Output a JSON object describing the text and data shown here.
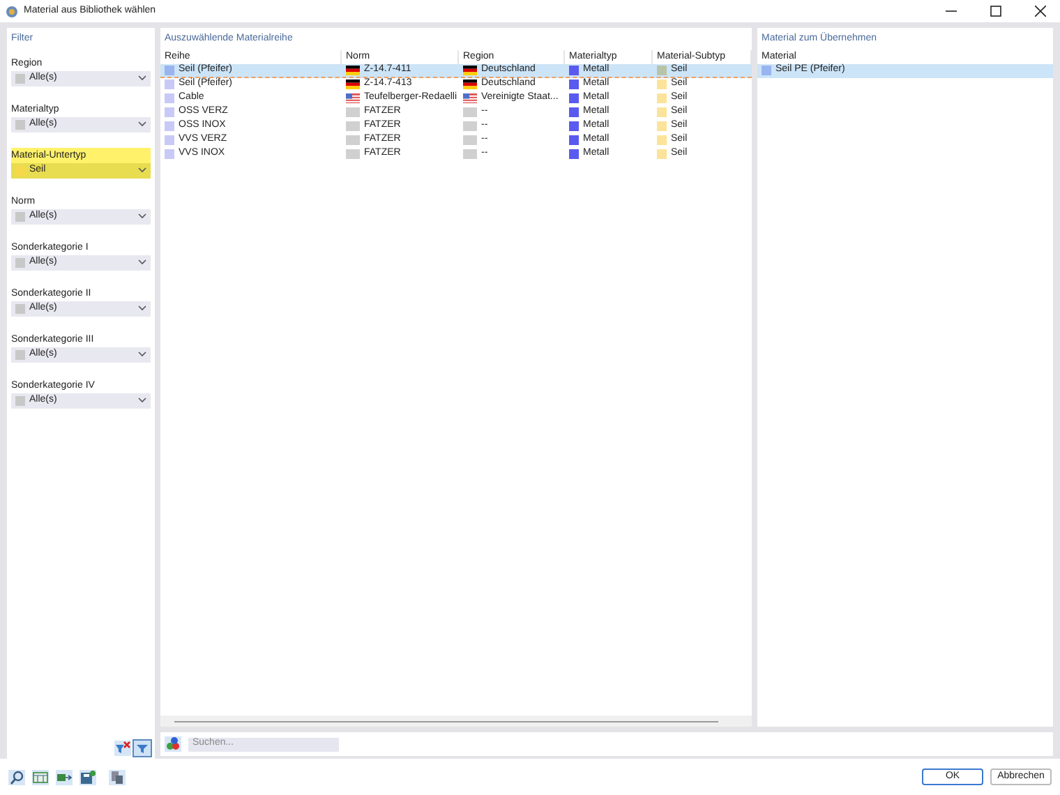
{
  "window": {
    "title": "Material aus Bibliothek wählen"
  },
  "filter": {
    "title": "Filter",
    "groups": [
      {
        "label": "Region",
        "value": "Alle(s)",
        "color": "#c8c8c8",
        "highlighted": false
      },
      {
        "label": "Materialtyp",
        "value": "Alle(s)",
        "color": "#c8c8c8",
        "highlighted": false
      },
      {
        "label": "Material-Untertyp",
        "value": "Seil",
        "color": "#f5d94a",
        "highlighted": true
      },
      {
        "label": "Norm",
        "value": "Alle(s)",
        "color": "#c8c8c8",
        "highlighted": false
      },
      {
        "label": "Sonderkategorie I",
        "value": "Alle(s)",
        "color": "#c8c8c8",
        "highlighted": false
      },
      {
        "label": "Sonderkategorie II",
        "value": "Alle(s)",
        "color": "#c8c8c8",
        "highlighted": false
      },
      {
        "label": "Sonderkategorie III",
        "value": "Alle(s)",
        "color": "#c8c8c8",
        "highlighted": false
      },
      {
        "label": "Sonderkategorie IV",
        "value": "Alle(s)",
        "color": "#c8c8c8",
        "highlighted": false
      }
    ]
  },
  "series_table": {
    "title": "Auszuwählende Materialreihe",
    "columns": [
      "Reihe",
      "Norm",
      "Region",
      "Materialtyp",
      "Material-Subtyp"
    ],
    "rows": [
      {
        "selected": true,
        "reihe": {
          "text": "Seil (Pfeifer)",
          "color": "#99b4ee"
        },
        "norm": {
          "text": "Z-14.7-411",
          "kind": "de"
        },
        "region": {
          "text": "Deutschland",
          "kind": "de"
        },
        "materialtyp": {
          "text": "Metall",
          "color": "#5a5af0"
        },
        "subtyp": {
          "text": "Seil",
          "color": "#b8c4a8"
        }
      },
      {
        "selected": false,
        "reihe": {
          "text": "Seil (Pfeifer)",
          "color": "#c9c9f7"
        },
        "norm": {
          "text": "Z-14.7-413",
          "kind": "de"
        },
        "region": {
          "text": "Deutschland",
          "kind": "de"
        },
        "materialtyp": {
          "text": "Metall",
          "color": "#5a5af0"
        },
        "subtyp": {
          "text": "Seil",
          "color": "#fbe49a"
        }
      },
      {
        "selected": false,
        "reihe": {
          "text": "Cable",
          "color": "#c9c9f7"
        },
        "norm": {
          "text": "Teufelberger-Redaelli",
          "kind": "us"
        },
        "region": {
          "text": "Vereinigte Staat...",
          "kind": "us"
        },
        "materialtyp": {
          "text": "Metall",
          "color": "#5a5af0"
        },
        "subtyp": {
          "text": "Seil",
          "color": "#fbe49a"
        }
      },
      {
        "selected": false,
        "reihe": {
          "text": "OSS VERZ",
          "color": "#c9c9f7"
        },
        "norm": {
          "text": "FATZER",
          "kind": "none"
        },
        "region": {
          "text": "--",
          "kind": "none"
        },
        "materialtyp": {
          "text": "Metall",
          "color": "#5a5af0"
        },
        "subtyp": {
          "text": "Seil",
          "color": "#fbe49a"
        }
      },
      {
        "selected": false,
        "reihe": {
          "text": "OSS INOX",
          "color": "#c9c9f7"
        },
        "norm": {
          "text": "FATZER",
          "kind": "none"
        },
        "region": {
          "text": "--",
          "kind": "none"
        },
        "materialtyp": {
          "text": "Metall",
          "color": "#5a5af0"
        },
        "subtyp": {
          "text": "Seil",
          "color": "#fbe49a"
        }
      },
      {
        "selected": false,
        "reihe": {
          "text": "VVS VERZ",
          "color": "#c9c9f7"
        },
        "norm": {
          "text": "FATZER",
          "kind": "none"
        },
        "region": {
          "text": "--",
          "kind": "none"
        },
        "materialtyp": {
          "text": "Metall",
          "color": "#5a5af0"
        },
        "subtyp": {
          "text": "Seil",
          "color": "#fbe49a"
        }
      },
      {
        "selected": false,
        "reihe": {
          "text": "VVS INOX",
          "color": "#c9c9f7"
        },
        "norm": {
          "text": "FATZER",
          "kind": "none"
        },
        "region": {
          "text": "--",
          "kind": "none"
        },
        "materialtyp": {
          "text": "Metall",
          "color": "#5a5af0"
        },
        "subtyp": {
          "text": "Seil",
          "color": "#fbe49a"
        }
      }
    ]
  },
  "take_table": {
    "title": "Material zum Übernehmen",
    "column": "Material",
    "rows": [
      {
        "selected": true,
        "text": "Seil PE (Pfeifer)",
        "color": "#99b4ee"
      }
    ]
  },
  "search": {
    "placeholder": "Suchen..."
  },
  "buttons": [
    {
      "label": "OK",
      "default": true
    },
    {
      "label": "Abbrechen",
      "default": false
    }
  ]
}
